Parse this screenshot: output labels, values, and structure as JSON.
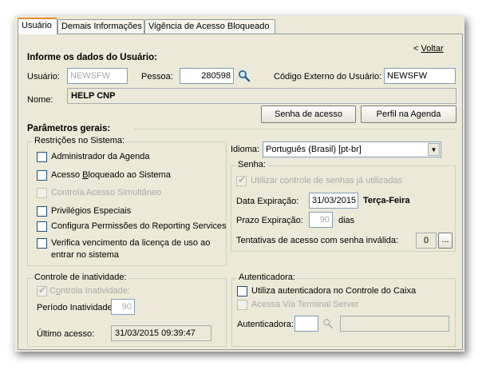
{
  "tabs": [
    {
      "label": "Usuário"
    },
    {
      "label": "Demais Informações"
    },
    {
      "label": "Vigência de Acesso Bloqueado"
    }
  ],
  "header": {
    "voltar_prefix": "< ",
    "voltar_label": "Voltar",
    "section_title": "Informe os dados do Usuário:"
  },
  "user": {
    "usuario_label": "Usuário:",
    "usuario_value": "NEWSFW",
    "pessoa_label": "Pessoa:",
    "pessoa_value": "280598",
    "codigo_externo_label": "Código Externo do Usuário:",
    "codigo_externo_value": "NEWSFW",
    "nome_label": "Nome:",
    "nome_value": "HELP CNP"
  },
  "buttons": {
    "senha_acesso": "Senha de acesso",
    "perfil_agenda": "Perfil na Agenda"
  },
  "params": {
    "title": "Parâmetros gerais:",
    "restricoes_title": "Restrições no Sistema:",
    "restricoes": [
      {
        "label_pre": "Administrador da Agenda",
        "label_u": "",
        "label_post": "",
        "enabled": true,
        "checked": false
      },
      {
        "label_pre": "Acesso ",
        "label_u": "B",
        "label_post": "loqueado ao Sistema",
        "enabled": true,
        "checked": false
      },
      {
        "label_pre": "Controla Acesso Simultâneo",
        "label_u": "",
        "label_post": "",
        "enabled": false,
        "checked": false
      },
      {
        "label_pre": "Privilégios Especiais",
        "label_u": "",
        "label_post": "",
        "enabled": true,
        "checked": false
      },
      {
        "label_pre": "Configura Permissões do Reporting Services",
        "label_u": "",
        "label_post": "",
        "enabled": true,
        "checked": false
      },
      {
        "label_pre": "Verifica vencimento da licença de uso ao",
        "label_u": "",
        "label_post": "",
        "enabled": true,
        "checked": false
      }
    ],
    "restricoes_last_line2": "entrar no sistema",
    "idioma_label": "Idioma:",
    "idioma_value": "Português (Brasil) [pt-br]",
    "senha_title": "Senha:",
    "utilizar_controle_label": "Utilizar controle de senhas já utilizadas",
    "data_expiracao_label": "Data Expiração:",
    "data_expiracao_value": "31/03/2015",
    "dia_semana": "Terça-Feira",
    "prazo_expiracao_label": "Prazo Expiração:",
    "prazo_expiracao_value": "90",
    "prazo_unit": "dias",
    "tentativas_label": "Tentativas de acesso com senha inválida:",
    "tentativas_value": "0",
    "ellipsis_label": "..."
  },
  "inatividade": {
    "title": "Controle de inatividade:",
    "controla_pre": "C",
    "controla_u": "o",
    "controla_post": "ntrola Inatividade:",
    "periodo_label": "Período Inatividade:",
    "periodo_value": "90",
    "ultimo_label": "Último acesso:",
    "ultimo_value": "31/03/2015 09:39:47"
  },
  "autenticadora": {
    "title": "Autenticadora:",
    "utiliza_label": "Utiliza autenticadora no Controle do Caixa",
    "acessa_label": "Acessa Via Terminal Server",
    "autenticadora_label": "Autenticadora:"
  }
}
